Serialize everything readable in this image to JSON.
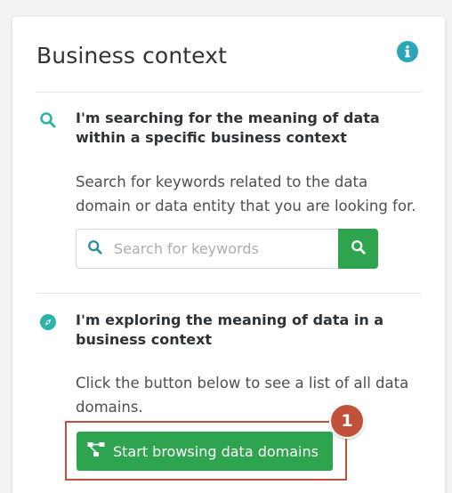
{
  "card": {
    "title": "Business context"
  },
  "search_section": {
    "heading": "I'm searching for the meaning of data within a specific business context",
    "description": "Search for keywords related to the data domain or data entity that you are looking for.",
    "search_placeholder": "Search for keywords",
    "search_value": ""
  },
  "browse_section": {
    "heading": "I'm exploring the meaning of data in a business context",
    "description": "Click the button below to see a list of all data domains.",
    "button_label": "Start browsing data domains"
  },
  "annotation": {
    "step_number": "1"
  },
  "icons": {
    "info": "info-icon",
    "search": "search-icon",
    "compass": "compass-icon",
    "hierarchy": "hierarchy-icon"
  },
  "colors": {
    "accent_teal": "#2bb5a8",
    "button_green": "#2ea44f",
    "annotation_red": "#c0523b"
  }
}
